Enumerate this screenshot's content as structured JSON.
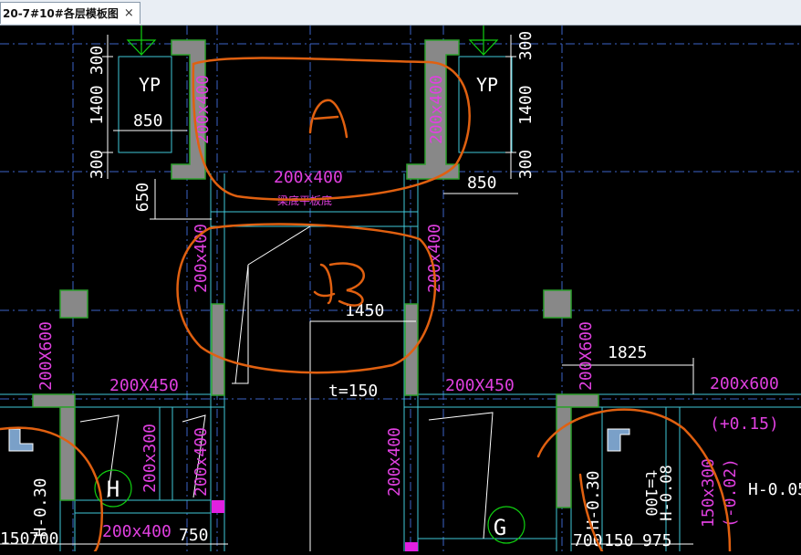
{
  "window": {
    "tab_title": "20-7#10#各层模板图",
    "close_glyph": "×"
  },
  "drawing": {
    "dims": {
      "d300a": "300",
      "d1400a": "1400",
      "d300b": "300",
      "d300c": "300",
      "d1400b": "1400",
      "d300d": "300",
      "d850a": "850",
      "d850b": "850",
      "d650": "650",
      "d1450": "1450",
      "d1825": "1825",
      "d750": "750",
      "d150": "150",
      "d700a": "700",
      "d700b": "700",
      "d150b": "150",
      "d975": "975"
    },
    "labels": {
      "yp_left": "YP",
      "yp_right": "YP",
      "beam_200x400_vl1": "200x400",
      "beam_200x400_vr1": "200x400",
      "beam_200x400_top": "200x400",
      "beam_note": "梁底平板底",
      "beam_200x400_vl2": "200x400",
      "beam_200x400_vr2": "200x400",
      "beam_200x600_left": "200X600",
      "beam_200x450_left": "200X450",
      "slab_t150": "t=150",
      "beam_200x450_right": "200X450",
      "beam_200x600_right": "200x600",
      "beam_200x600_vert": "200X600",
      "elev_plus015": "(+0.15)",
      "beam_200x300": "200x300",
      "beam_200x400_v3": "200x400",
      "beam_200x400_v4": "200x400",
      "beam_200x400_bottom": "200x400",
      "elev_h030_left": "H-0.30",
      "elev_h030_right": "H-0.30",
      "slab_t100": "t=100",
      "elev_h008": "H-0.08",
      "beam_150x300": "150x300",
      "elev_minus002": "(-0.02)",
      "elev_h005": "H-0.05"
    },
    "annotations": {
      "mark_a": "A",
      "mark_b": "B",
      "circle_h": "H",
      "circle_g": "G"
    },
    "colors": {
      "beam_text": "#e040e0",
      "dim_text": "#ffffff",
      "grid": "#3c64c8",
      "wall": "#888888",
      "wall_edge": "#2ea02e",
      "markup": "#e06010",
      "axis_bubble": "#10d010"
    }
  }
}
